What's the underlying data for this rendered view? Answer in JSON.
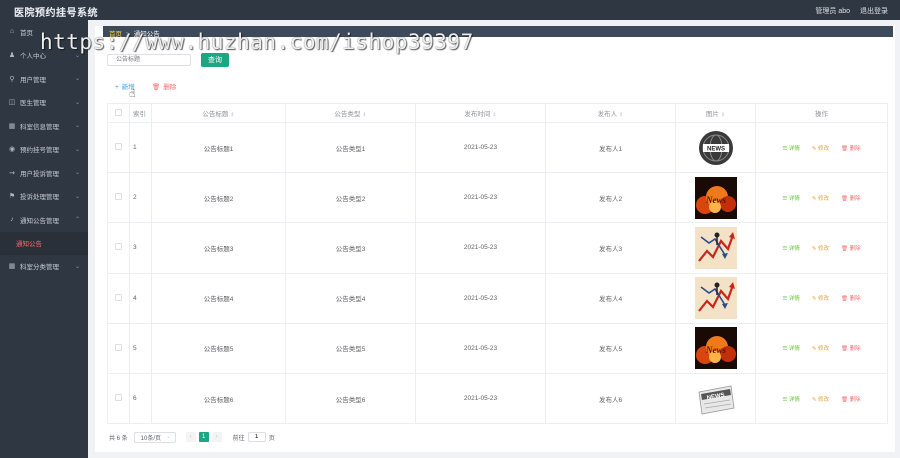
{
  "app": {
    "title": "医院预约挂号系统",
    "user_label": "管理员 abo",
    "logout_label": "退出登录"
  },
  "sidebar": {
    "items": [
      {
        "label": "首页",
        "icon": "home-icon",
        "glyph": "⌂",
        "has_chevron": false
      },
      {
        "label": "个人中心",
        "icon": "user-icon",
        "glyph": "♟",
        "has_chevron": true
      },
      {
        "label": "用户管理",
        "icon": "mic-icon",
        "glyph": "⚲",
        "has_chevron": true
      },
      {
        "label": "医生管理",
        "icon": "doctor-icon",
        "glyph": "◫",
        "has_chevron": true
      },
      {
        "label": "科室信息管理",
        "icon": "grid-icon",
        "glyph": "▦",
        "has_chevron": true
      },
      {
        "label": "预约挂号管理",
        "icon": "ticket-icon",
        "glyph": "◉",
        "has_chevron": true
      },
      {
        "label": "用户投诉管理",
        "icon": "share-icon",
        "glyph": "⇝",
        "has_chevron": true
      },
      {
        "label": "投诉处理管理",
        "icon": "flag-icon",
        "glyph": "⚑",
        "has_chevron": true
      },
      {
        "label": "通知公告管理",
        "icon": "bell-icon",
        "glyph": "♪",
        "has_chevron": true
      }
    ],
    "sub_item": "通知公告",
    "last_item": {
      "label": "科室分类管理",
      "icon": "grid-icon",
      "glyph": "▦"
    }
  },
  "breadcrumb": {
    "home": "首页",
    "current": "通知公告"
  },
  "search": {
    "placeholder": "公告标题",
    "button": "查询"
  },
  "actions": {
    "add": "新增",
    "delete": "删除"
  },
  "table": {
    "headers": [
      "索引",
      "公告标题",
      "公告类型",
      "发布时间",
      "发布人",
      "图片",
      "操作"
    ],
    "rows": [
      {
        "index": "1",
        "title": "公告标题1",
        "type": "公告类型1",
        "time": "2021-05-23",
        "publisher": "发布人1",
        "image": "news-globe"
      },
      {
        "index": "2",
        "title": "公告标题2",
        "type": "公告类型2",
        "time": "2021-05-23",
        "publisher": "发布人2",
        "image": "fire-text"
      },
      {
        "index": "3",
        "title": "公告标题3",
        "type": "公告类型3",
        "time": "2021-05-23",
        "publisher": "发布人3",
        "image": "chart-arrows"
      },
      {
        "index": "4",
        "title": "公告标题4",
        "type": "公告类型4",
        "time": "2021-05-23",
        "publisher": "发布人4",
        "image": "chart-arrows"
      },
      {
        "index": "5",
        "title": "公告标题5",
        "type": "公告类型5",
        "time": "2021-05-23",
        "publisher": "发布人5",
        "image": "fire-text"
      },
      {
        "index": "6",
        "title": "公告标题6",
        "type": "公告类型6",
        "time": "2021-05-23",
        "publisher": "发布人6",
        "image": "news-paper"
      }
    ],
    "row_actions": {
      "detail": "详情",
      "edit": "修改",
      "delete": "删除"
    }
  },
  "pagination": {
    "total": "共 6 条",
    "page_size": "10条/页",
    "current_page": "1",
    "goto_label": "前往",
    "goto_value": "1",
    "page_suffix": "页"
  },
  "watermark": "https://www.huzhan.com/ishop39397",
  "colors": {
    "sidebar_bg": "#2f3742",
    "primary": "#1ba784",
    "link": "#409eff",
    "danger": "#f56c6c",
    "warning": "#e6a23c",
    "success": "#67c23a"
  }
}
